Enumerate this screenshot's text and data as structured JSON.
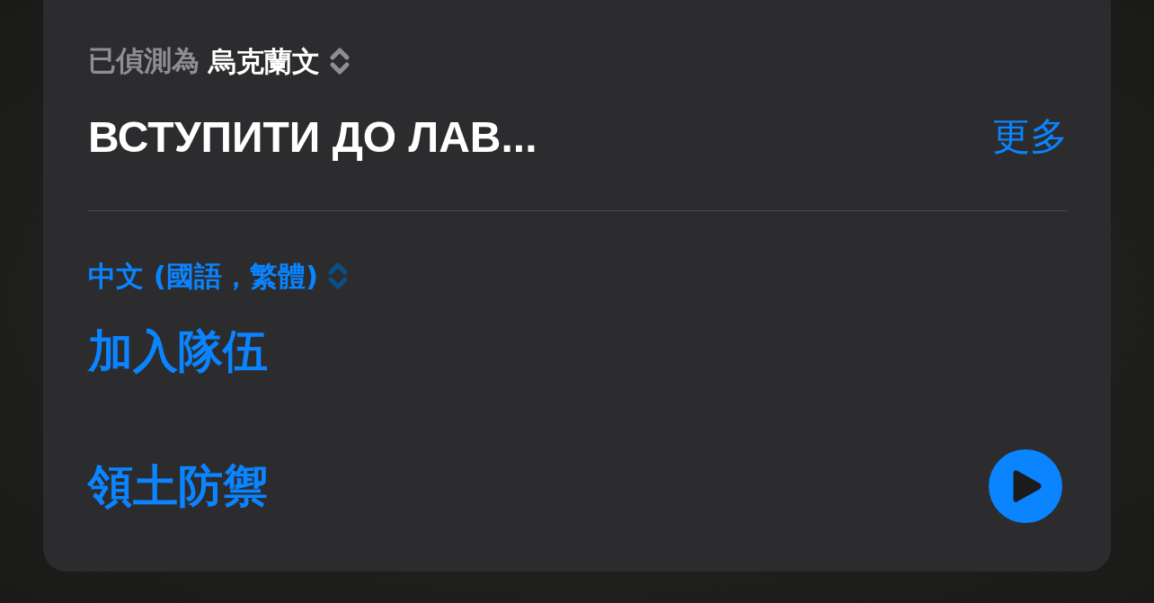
{
  "detected": {
    "label": "已偵測為",
    "language": "烏克蘭文"
  },
  "source_text": "ВСТУПИТИ ДО ЛАВ...",
  "more_link": "更多",
  "target": {
    "language": "中文 (國語，繁體)"
  },
  "translations": [
    "加入隊伍",
    "領土防禦"
  ]
}
